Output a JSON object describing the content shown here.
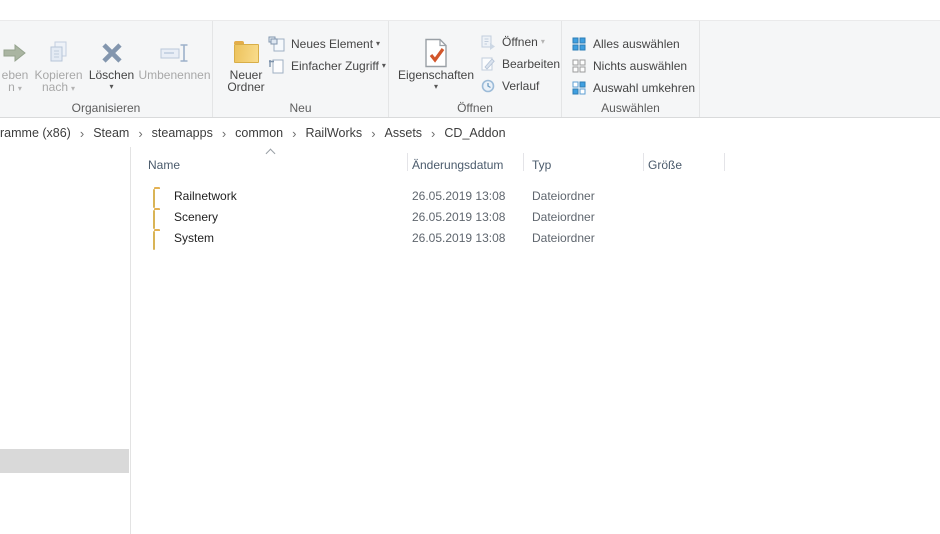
{
  "ribbon": {
    "groups": [
      {
        "label": "Organisieren"
      },
      {
        "label": "Neu"
      },
      {
        "label": "Öffnen"
      },
      {
        "label": "Auswählen"
      }
    ],
    "buttons": {
      "move_to": {
        "visible_line1": "eben",
        "visible_line2": "n",
        "disabled": true
      },
      "copy_to": {
        "line1": "Kopieren",
        "line2": "nach",
        "disabled": true
      },
      "delete": {
        "label": "Löschen",
        "disabled": false
      },
      "rename": {
        "label": "Umbenennen",
        "disabled": true
      },
      "new_folder": {
        "line1": "Neuer",
        "line2": "Ordner",
        "disabled": false
      },
      "new_item": {
        "label": "Neues Element",
        "disabled": false
      },
      "easy_access": {
        "label": "Einfacher Zugriff",
        "disabled": false
      },
      "properties": {
        "label": "Eigenschaften",
        "disabled": false
      },
      "open": {
        "label": "Öffnen",
        "disabled": true
      },
      "edit": {
        "label": "Bearbeiten",
        "disabled": true
      },
      "history": {
        "label": "Verlauf",
        "disabled": true
      },
      "select_all": {
        "label": "Alles auswählen",
        "disabled": false
      },
      "select_none": {
        "label": "Nichts auswählen",
        "disabled": false
      },
      "invert_selection": {
        "label": "Auswahl umkehren",
        "disabled": false
      }
    }
  },
  "breadcrumb": {
    "items": [
      "ramme (x86)",
      "Steam",
      "steamapps",
      "common",
      "RailWorks",
      "Assets",
      "CD_Addon"
    ],
    "separator": "›"
  },
  "file_list": {
    "columns": [
      "Name",
      "Änderungsdatum",
      "Typ",
      "Größe"
    ],
    "sort": {
      "column": "Name",
      "direction": "ascending"
    },
    "rows": [
      {
        "name": "Railnetwork",
        "modified": "26.05.2019 13:08",
        "type": "Dateiordner",
        "size": ""
      },
      {
        "name": "Scenery",
        "modified": "26.05.2019 13:08",
        "type": "Dateiordner",
        "size": ""
      },
      {
        "name": "System",
        "modified": "26.05.2019 13:08",
        "type": "Dateiordner",
        "size": ""
      }
    ]
  },
  "icons": {
    "dropdown_caret": "▾",
    "breadcrumb_separator": "›"
  },
  "colors": {
    "ribbon_bg": "#f5f6f7",
    "accent_blue": "#3f9fe0",
    "folder_yellow": "#f7d06b",
    "enabled_text": "#454545",
    "disabled_text": "#a8a8a8",
    "header_text": "#4b5b6c",
    "nav_thumb": "#d9d9d9"
  }
}
